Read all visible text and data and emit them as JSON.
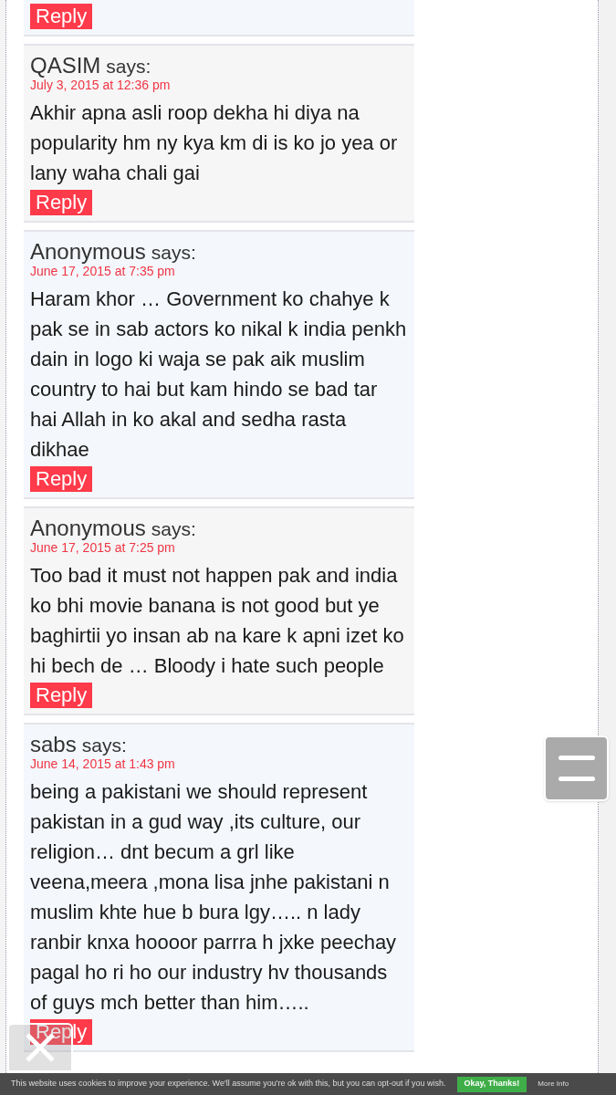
{
  "comments": [
    {
      "reply": "Reply"
    },
    {
      "author": "QASIM",
      "says": "says:",
      "date": "July 3, 2015 at 12:36 pm",
      "text": "Akhir apna asli roop dekha hi diya na popularity hm ny kya km di is ko jo yea or lany waha chali gai",
      "reply": "Reply"
    },
    {
      "author": "Anonymous",
      "says": "says:",
      "date": "June 17, 2015 at 7:35 pm",
      "text": "Haram khor … Government ko chahye k pak se in sab actors ko nikal k india penkh dain in logo ki waja se pak aik muslim country to hai but kam hindo se bad tar hai Allah in ko akal and sedha rasta dikhae",
      "reply": "Reply"
    },
    {
      "author": "Anonymous",
      "says": "says:",
      "date": "June 17, 2015 at 7:25 pm",
      "text": "Too bad it must not happen pak and india ko bhi movie banana is not good but ye baghirtii yo insan ab na kare k apni izet ko hi bech de … Bloody i hate such people",
      "reply": "Reply"
    },
    {
      "author": "sabs",
      "says": "says:",
      "date": "June 14, 2015 at 1:43 pm",
      "text": "being a pakistani we should represent pakistan in a gud way ,its culture, our religion… dnt becum a grl like veena,meera ,mona lisa jnhe pakistani n muslim khte hue b bura lgy….. n lady ranbir knxa hoooor parrra h jxke peechay pagal ho ri ho our industry hv thousands of guys mch better than him…..",
      "reply": "Reply"
    }
  ],
  "cookie_bar": {
    "text": "This website uses cookies to improve your experience. We'll assume you're ok with this, but you can opt-out if you wish.",
    "accept": "Okay, Thanks!",
    "more": "More Info"
  }
}
